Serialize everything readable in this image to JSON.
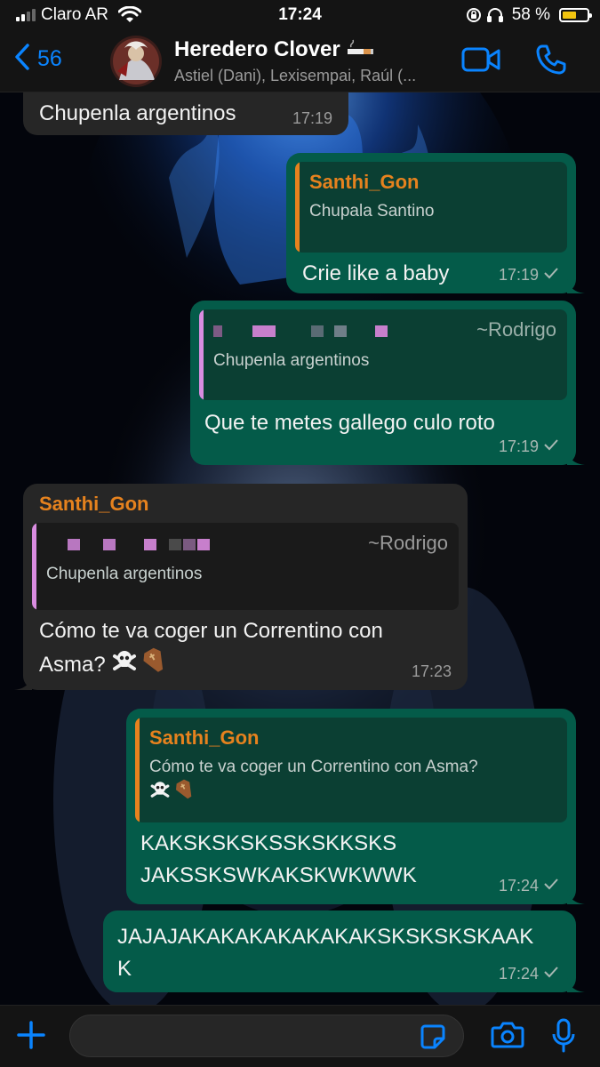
{
  "status_bar": {
    "carrier": "Claro AR",
    "time": "17:24",
    "battery_percent_text": "58 %",
    "battery_level": 0.58,
    "icons": [
      "signal-icon",
      "wifi-icon",
      "orientation-lock-icon",
      "headphones-icon",
      "battery-icon"
    ]
  },
  "header": {
    "back_count": "56",
    "title": "Heredero Clover",
    "title_emoji": "cigarette",
    "members": "Astiel (Dani), Lexisempai, Raúl (...",
    "accent_color": "#0a84ff",
    "icons": [
      "chevron-left-icon",
      "video-camera-icon",
      "phone-icon"
    ]
  },
  "messages": [
    {
      "direction": "in",
      "text": "Chupenla argentinos",
      "time": "17:19"
    },
    {
      "direction": "out",
      "quote": {
        "author": "Santhi_Gon",
        "text": "Chupala Santino",
        "bar_color": "#e6821e"
      },
      "text": "Crie like a baby",
      "time": "17:19",
      "status": "sent"
    },
    {
      "direction": "out",
      "quote": {
        "author_hidden": true,
        "handle": "~Rodrigo",
        "text": "Chupenla argentinos",
        "bar_color": "#d98ce0"
      },
      "text": "Que te metes gallego culo roto",
      "time": "17:19",
      "status": "sent"
    },
    {
      "direction": "in",
      "sender": "Santhi_Gon",
      "quote": {
        "author_hidden": true,
        "handle": "~Rodrigo",
        "text": "Chupenla argentinos",
        "bar_color": "#d98ce0"
      },
      "text": "Cómo te va coger un Correntino con Asma?",
      "emojis": [
        "skull-crossbones",
        "coffin"
      ],
      "time": "17:23"
    },
    {
      "direction": "out",
      "quote": {
        "author": "Santhi_Gon",
        "text": "Cómo te va coger un Correntino con Asma?",
        "emojis": [
          "skull-crossbones",
          "coffin"
        ],
        "bar_color": "#e6821e"
      },
      "text_lines": [
        "KAKSKSKSKSSKSKKSKS",
        "JAKSSKSWKAKSKWKWWK"
      ],
      "time": "17:24",
      "status": "sent"
    },
    {
      "direction": "out",
      "text_lines": [
        "JAJAJAKAKAKAKAKAKAKSKSKSKSKAAK",
        "K"
      ],
      "time": "17:24",
      "status": "sent"
    }
  ],
  "input": {
    "placeholder": "",
    "icons": [
      "plus-icon",
      "sticker-icon",
      "camera-icon",
      "microphone-icon"
    ]
  },
  "colors": {
    "incoming_bubble": "#262626",
    "outgoing_bubble": "#045b49",
    "sender_name": "#e6821e",
    "tick": "#a8b8b3"
  }
}
